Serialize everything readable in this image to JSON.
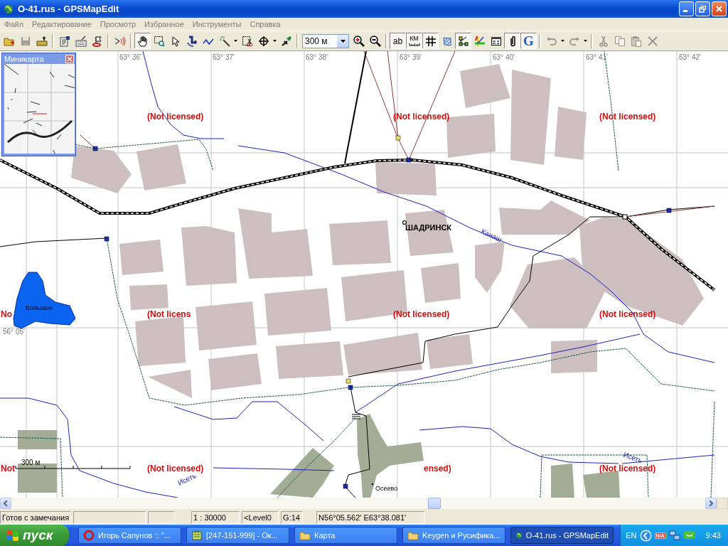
{
  "window": {
    "title": "O-41.rus - GPSMapEdit"
  },
  "menu": [
    "Файл",
    "Редактирование",
    "Просмотр",
    "Избранное",
    "Инструменты",
    "Справка"
  ],
  "toolbar": {
    "scale_value": "300 м",
    "buttons": [
      {
        "pressed": false,
        "disabled": false
      },
      {
        "pressed": false,
        "disabled": true
      },
      {
        "pressed": false,
        "disabled": false
      },
      {
        "pressed": false,
        "disabled": false
      },
      {
        "pressed": false,
        "disabled": false
      },
      {
        "pressed": false,
        "disabled": false
      },
      {
        "pressed": false,
        "disabled": false
      },
      {
        "pressed": true,
        "disabled": false
      },
      {
        "pressed": false,
        "disabled": false
      },
      {
        "pressed": false,
        "disabled": false
      },
      {
        "pressed": false,
        "disabled": false
      },
      {
        "pressed": false,
        "disabled": false
      },
      {
        "pressed": false,
        "disabled": false
      },
      {
        "pressed": false,
        "disabled": false
      },
      {
        "pressed": false,
        "disabled": false
      },
      {
        "pressed": false,
        "disabled": false
      },
      {
        "pressed": false,
        "disabled": false
      },
      {
        "pressed": false,
        "disabled": false
      },
      {
        "label": "ab",
        "pressed": true,
        "disabled": false
      },
      {
        "label": "КМ",
        "pressed": true,
        "disabled": false
      },
      {
        "pressed": true,
        "disabled": false
      },
      {
        "pressed": false,
        "disabled": false
      },
      {
        "pressed": true,
        "disabled": false
      },
      {
        "pressed": false,
        "disabled": false
      },
      {
        "pressed": false,
        "disabled": false
      },
      {
        "pressed": true,
        "disabled": false
      },
      {
        "label": "G",
        "pressed": true,
        "disabled": false
      },
      {
        "pressed": false,
        "disabled": true
      },
      {
        "pressed": false,
        "disabled": true
      },
      {
        "pressed": false,
        "disabled": true
      },
      {
        "pressed": false,
        "disabled": true
      },
      {
        "pressed": false,
        "disabled": true
      },
      {
        "pressed": false,
        "disabled": true
      }
    ]
  },
  "minimap": {
    "title": "Миникарта"
  },
  "map": {
    "grid_labels": [
      "63° 36'",
      "63° 37'",
      "63° 38'",
      "63° 39'",
      "63° 40'",
      "63° 41'",
      "63° 42'",
      "56° 05'"
    ],
    "overlay_labels": [
      "(Not licensed)",
      "(Not licensed)",
      "(Not licensed)",
      "No",
      "(Not licens",
      "(Not licensed)",
      "(Not licensed)",
      "Not",
      "(Not licensed)",
      "ensed)",
      "(Not licensed)"
    ],
    "places": [
      {
        "name": "ШАДРИНСК",
        "kind": "city"
      },
      {
        "name": "Канаш",
        "kind": "river"
      },
      {
        "name": "Большое",
        "kind": "lake"
      },
      {
        "name": "Исеть",
        "kind": "river"
      },
      {
        "name": "Исеть",
        "kind": "river"
      },
      {
        "name": "Осеево",
        "kind": "village"
      }
    ],
    "scale_label": "300 м"
  },
  "status_bar": {
    "message": "Готов с замечания",
    "scale": "1 : 30000",
    "map_level": "<Level0",
    "grid": "G:14",
    "coordinates": "N56°05.562' E63°38.081'"
  },
  "taskbar": {
    "start": "пуск",
    "tasks": [
      {
        "label": "Игорь Сапунов :: \"...",
        "selected": false
      },
      {
        "label": "[247-151-999] - Ок...",
        "selected": false
      },
      {
        "label": "Карта",
        "selected": false
      },
      {
        "label": "Keygen и Русифика...",
        "selected": false
      },
      {
        "label": "O-41.rus - GPSMapEdit",
        "selected": true
      }
    ],
    "language": "EN",
    "tray_badge": "N/A",
    "clock": "9:43"
  }
}
